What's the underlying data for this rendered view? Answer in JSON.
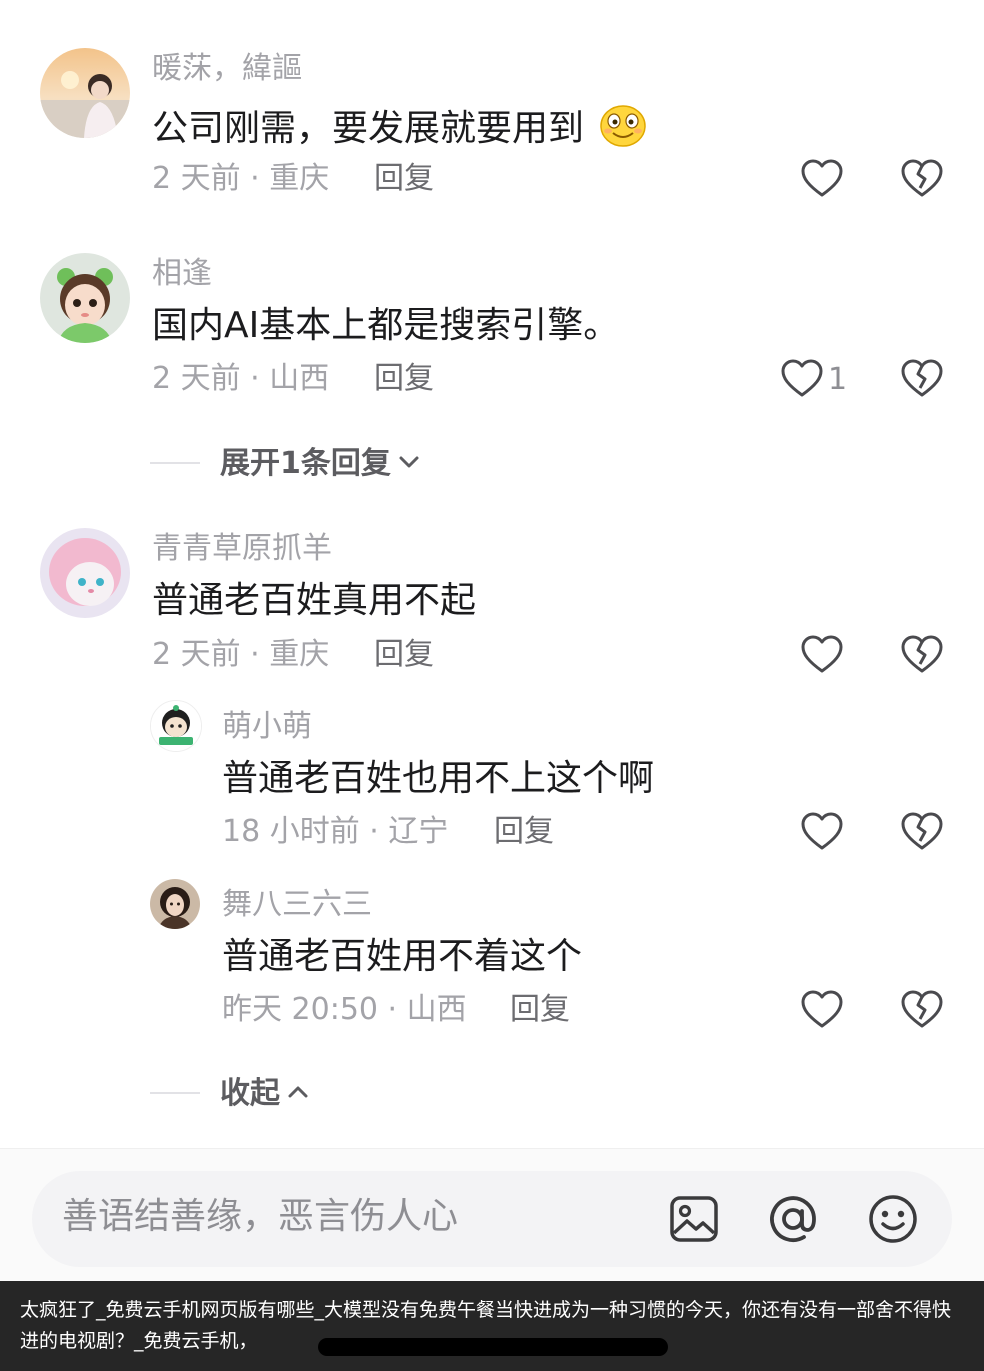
{
  "comments": [
    {
      "username": "暖莯，緯謳",
      "text": "公司刚需，要发展就要用到",
      "emoji_icon": "smiling-face-emoji",
      "meta": "2 天前 · 重庆",
      "reply_label": "回复",
      "like_count": ""
    },
    {
      "username": "相逢",
      "text": "国内AI基本上都是搜索引擎。",
      "meta": "2 天前 · 山西",
      "reply_label": "回复",
      "like_count": "1",
      "expand_label": "展开1条回复"
    },
    {
      "username": "青青草原抓羊",
      "text": "普通老百姓真用不起",
      "meta": "2 天前 · 重庆",
      "reply_label": "回复",
      "like_count": "",
      "replies": [
        {
          "username": "萌小萌",
          "text": "普通老百姓也用不上这个啊",
          "meta": "18 小时前 · 辽宁",
          "reply_label": "回复"
        },
        {
          "username": "舞八三六三",
          "text": "普通老百姓用不着这个",
          "meta": "昨天 20:50 · 山西",
          "reply_label": "回复"
        }
      ],
      "collapse_label": "收起"
    }
  ],
  "input_bar": {
    "placeholder": "善语结善缘，恶言伤人心",
    "icons": [
      "image-icon",
      "at-icon",
      "emoji-icon"
    ]
  },
  "caption": {
    "text": "太疯狂了_免费云手机网页版有哪些_大模型没有免费午餐当快进成为一种习惯的今天，你还有没有一部舍不得快进的电视剧？_免费云手机，"
  },
  "colors": {
    "username": "#a3a3a8",
    "comment_text": "#1c1c1e",
    "meta": "#a3a3a8",
    "icon_stroke": "#4a4a4e",
    "caption_bg": "#262626"
  }
}
